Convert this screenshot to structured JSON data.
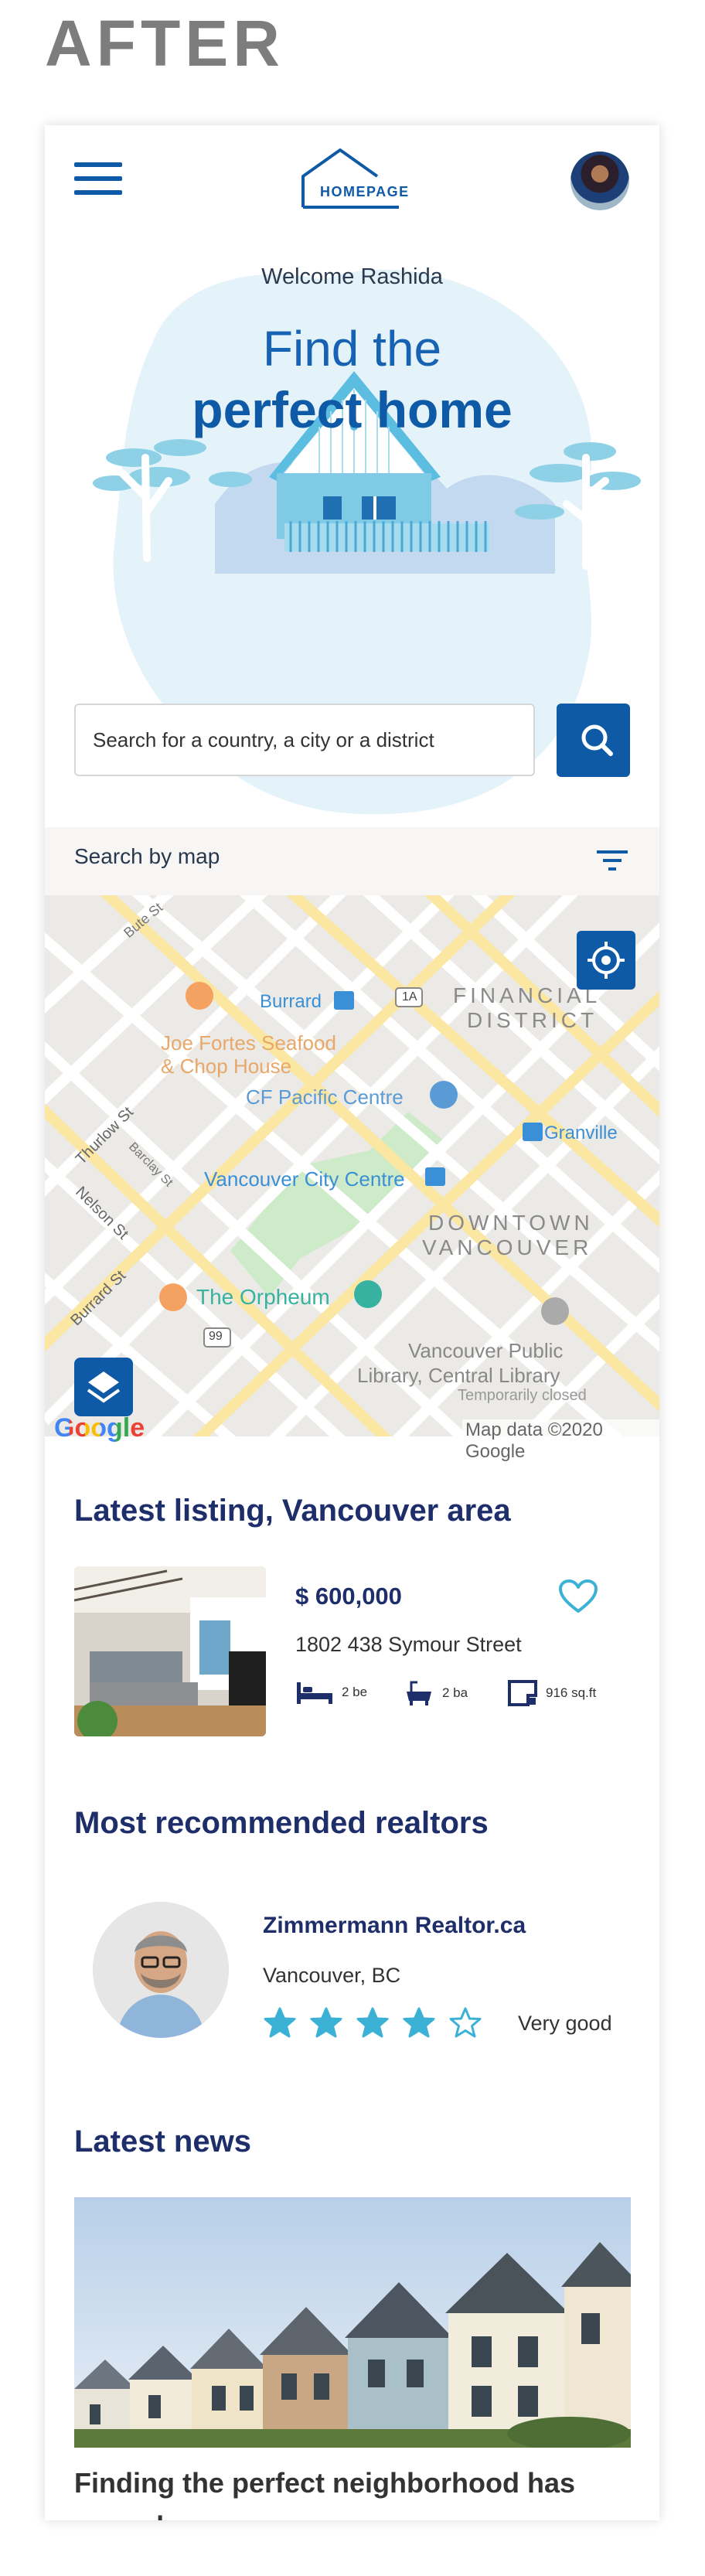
{
  "page_heading": "AFTER",
  "header": {
    "logo_text": "HOMEPAGE"
  },
  "hero": {
    "welcome": "Welcome Rashida",
    "title_line1": "Find the",
    "title_line2": "perfect home"
  },
  "search": {
    "placeholder": "Search for a country, a city or a district"
  },
  "map_bar": {
    "label": "Search by map"
  },
  "map": {
    "labels": {
      "bute": "Bute St",
      "burrard": "Burrard",
      "financial": "FINANCIAL",
      "district": "DISTRICT",
      "joe1": "Joe Fortes Seafood",
      "joe2": "& Chop House",
      "cf": "CF Pacific Centre",
      "granville": "Granville",
      "thurlow": "Thurlow St",
      "barclay": "Barclay St",
      "nelson": "Nelson St",
      "vcc": "Vancouver City Centre",
      "downtown": "DOWNTOWN",
      "vancouver": "VANCOUVER",
      "burrard_st": "Burrard St",
      "orpheum": "The Orpheum",
      "vpl1": "Vancouver Public",
      "vpl2": "Library, Central Library",
      "vpl3": "Temporarily closed",
      "hwy1a": "1A",
      "hwy99": "99"
    },
    "google": "Google",
    "attribution": "Map data ©2020 Google"
  },
  "listings": {
    "title": "Latest listing, Vancouver area",
    "item": {
      "price": "$ 600,000",
      "address": "1802 438 Symour Street",
      "beds": "2 be",
      "baths": "2 ba",
      "area": "916 sq.ft"
    }
  },
  "realtors": {
    "title": "Most recommended realtors",
    "item": {
      "name": "Zimmermann Realtor.ca",
      "city": "Vancouver, BC",
      "rating_text": "Very good",
      "rating": 4,
      "rating_max": 5
    }
  },
  "news": {
    "title": "Latest news",
    "item_title": "Finding the perfect neighborhood has never been so easy"
  },
  "colors": {
    "brand_blue": "#0f5aa6",
    "navy": "#1d2e6a",
    "accent_teal": "#3cb1d6",
    "heading_grey": "#7d7d7d"
  },
  "icons": [
    "hamburger-menu-icon",
    "house-logo-icon",
    "search-icon",
    "filter-icon",
    "locate-icon",
    "layers-icon",
    "heart-icon",
    "bed-icon",
    "bath-icon",
    "area-icon",
    "star-icon"
  ]
}
